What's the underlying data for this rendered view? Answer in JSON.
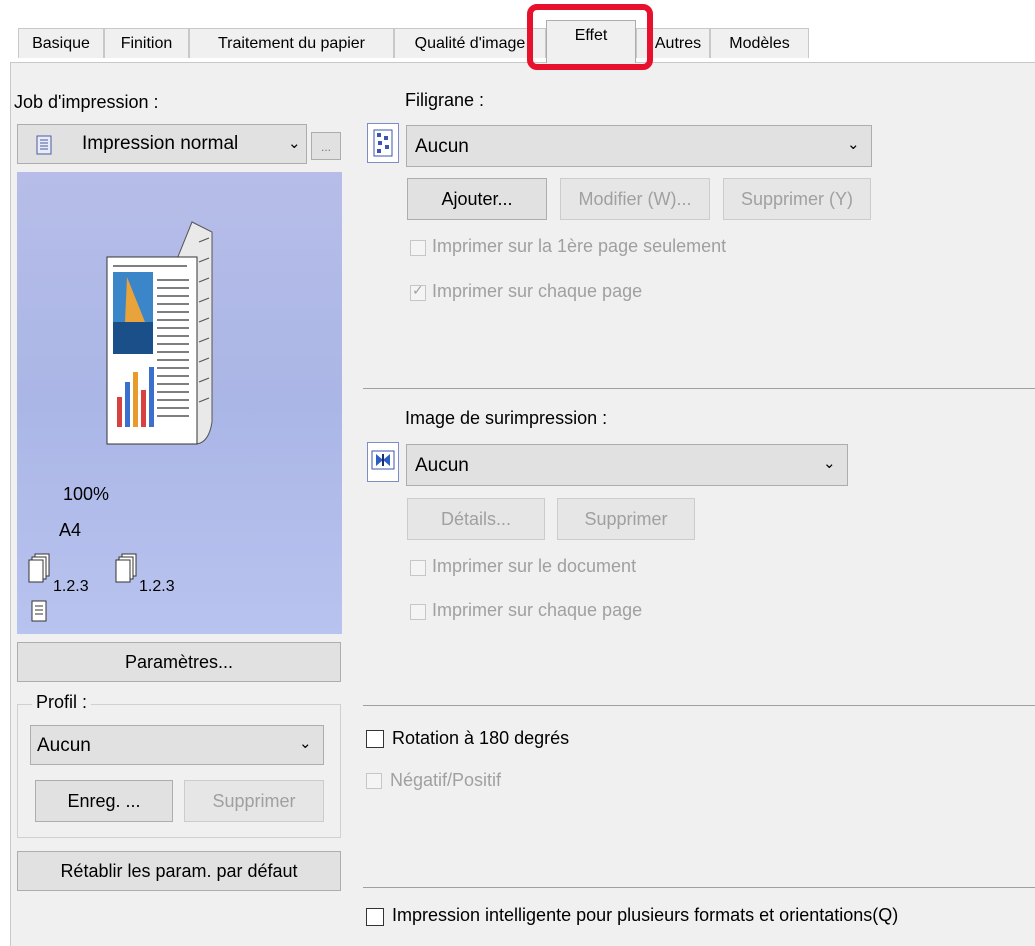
{
  "tabs": [
    {
      "label": "Basique"
    },
    {
      "label": "Finition"
    },
    {
      "label": "Traitement du papier"
    },
    {
      "label": "Qualité d'image"
    },
    {
      "label": "Effet"
    },
    {
      "label": "Autres"
    },
    {
      "label": "Modèles"
    }
  ],
  "active_tab": "Effet",
  "highlight_color": "#e8112d",
  "left": {
    "job_label": "Job d'impression :",
    "job_value": "Impression normal",
    "more_btn": "...",
    "preview": {
      "zoom": "100%",
      "paper": "A4",
      "collate1": "1.2.3",
      "collate2": "1.2.3"
    },
    "params_btn": "Paramètres...",
    "profile_label": "Profil :",
    "profile_value": "Aucun",
    "save_btn": "Enreg. ...",
    "delete_btn": "Supprimer",
    "reset_btn": "Rétablir les param. par défaut"
  },
  "watermark": {
    "label": "Filigrane :",
    "value": "Aucun",
    "add_btn": "Ajouter...",
    "edit_btn": "Modifier (W)...",
    "delete_btn": "Supprimer (Y)",
    "first_page_only": "Imprimer sur la 1ère page seulement",
    "every_page": "Imprimer sur chaque page",
    "every_page_checked": true
  },
  "overlay": {
    "label": "Image de surimpression :",
    "value": "Aucun",
    "details_btn": "Détails...",
    "delete_btn": "Supprimer",
    "on_document": "Imprimer sur le document",
    "every_page": "Imprimer sur chaque page"
  },
  "rotate180": "Rotation à 180 degrés",
  "negpos": "Négatif/Positif",
  "smart_print": "Impression intelligente pour plusieurs formats et orientations(Q)"
}
